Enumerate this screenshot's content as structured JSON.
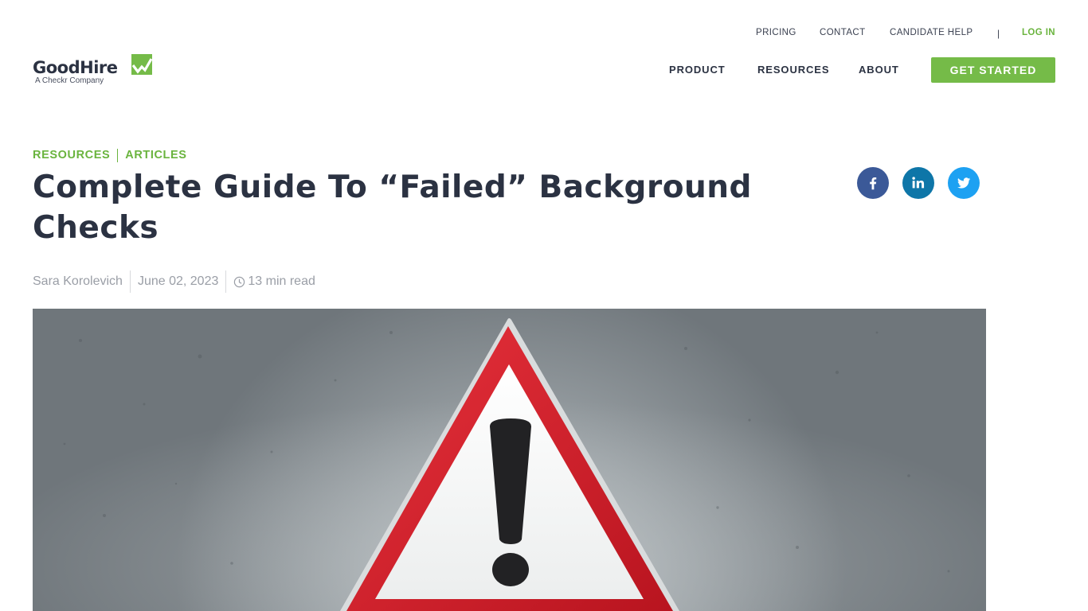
{
  "brand": {
    "name": "GoodHire",
    "tagline": "A Checkr Company",
    "accent_color": "#6ab43e",
    "icon": "checkmark-chart-icon"
  },
  "utility_nav": {
    "pricing": "PRICING",
    "contact": "CONTACT",
    "candidate_help": "CANDIDATE HELP",
    "separator": "|",
    "login": "LOG IN"
  },
  "main_nav": {
    "product": "PRODUCT",
    "resources": "RESOURCES",
    "about": "ABOUT",
    "cta": "GET STARTED"
  },
  "breadcrumb": [
    "RESOURCES",
    "ARTICLES"
  ],
  "article": {
    "title": "Complete Guide To “Failed” Background Checks",
    "author": "Sara Korolevich",
    "date": "June 02, 2023",
    "read_time": "13 min read",
    "hero_image": "warning-triangle-sign-on-concrete-wall"
  },
  "share": [
    {
      "network": "facebook",
      "icon": "facebook-icon",
      "color": "#3b5998"
    },
    {
      "network": "linkedin",
      "icon": "linkedin-icon",
      "color": "#0e76a8"
    },
    {
      "network": "twitter",
      "icon": "twitter-icon",
      "color": "#1da1f2"
    }
  ]
}
